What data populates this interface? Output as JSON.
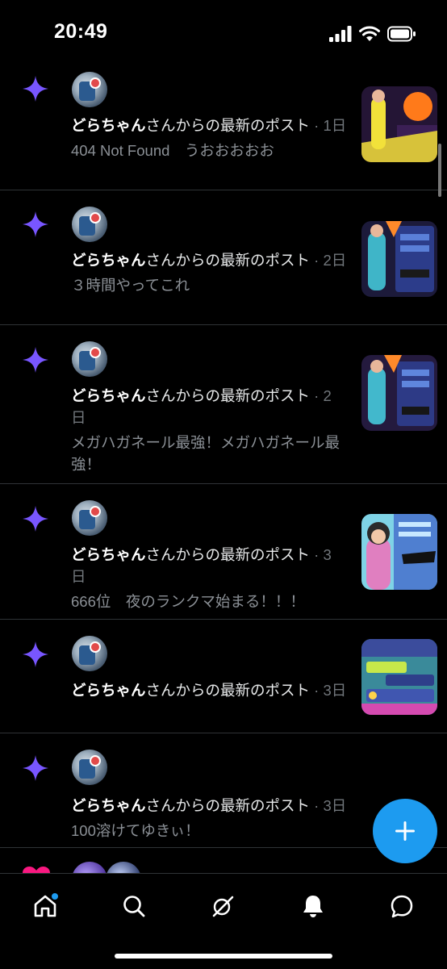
{
  "status_bar": {
    "time": "20:49"
  },
  "notifications": [
    {
      "name": "どらちゃん",
      "lead": "さんからの最新のポスト",
      "age": "1日",
      "snippet": "404 Not Found　うおおおおお",
      "has_thumb": true
    },
    {
      "name": "どらちゃん",
      "lead": "さんからの最新のポスト",
      "age": "2日",
      "snippet": "３時間やってこれ",
      "has_thumb": true
    },
    {
      "name": "どらちゃん",
      "lead": "さんからの最新のポスト",
      "age": "2日",
      "snippet": "メガハガネール最強！メガハガネール最強！",
      "has_thumb": true
    },
    {
      "name": "どらちゃん",
      "lead": "さんからの最新のポスト",
      "age": "3日",
      "snippet": "666位　夜のランクマ始まる！！！",
      "has_thumb": true
    },
    {
      "name": "どらちゃん",
      "lead": "さんからの最新のポスト",
      "age": "3日",
      "snippet": "",
      "has_thumb": true
    },
    {
      "name": "どらちゃん",
      "lead": "さんからの最新のポスト",
      "age": "3日",
      "snippet": "100溶けてゆきぃ！",
      "has_thumb": false
    }
  ],
  "meta_separator": " · ",
  "fab": {
    "icon": "plus-icon"
  },
  "tabbar": {
    "tabs": [
      {
        "name": "home",
        "icon": "home-icon",
        "active": true,
        "badge": true
      },
      {
        "name": "search",
        "icon": "search-icon"
      },
      {
        "name": "grok",
        "icon": "grok-icon"
      },
      {
        "name": "notifications",
        "icon": "bell-icon"
      },
      {
        "name": "messages",
        "icon": "message-icon"
      }
    ]
  },
  "colors": {
    "accent": "#1d9bf0",
    "sparkle": "#7856ff",
    "background": "#000000",
    "divider": "#2f3336",
    "meta": "#71767b"
  }
}
